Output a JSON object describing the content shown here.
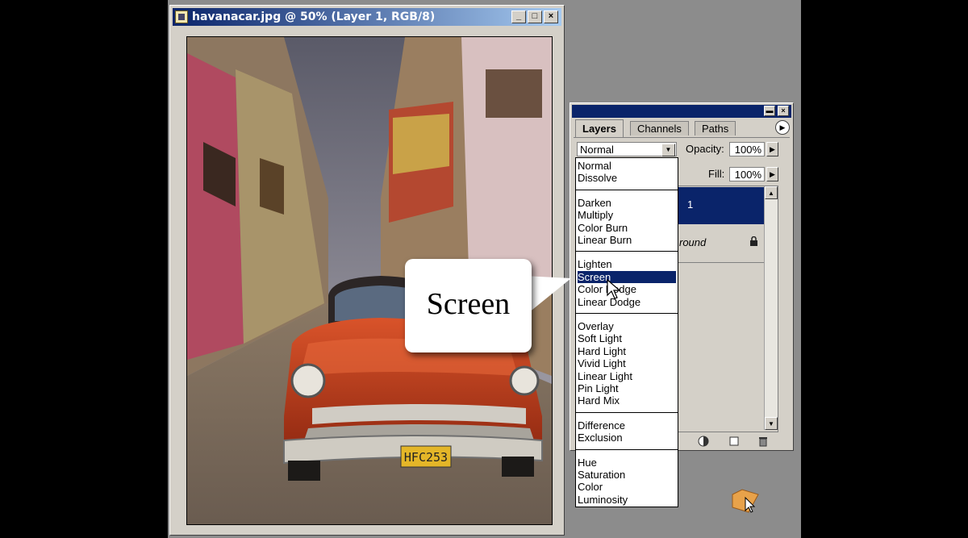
{
  "document": {
    "title": "havanacar.jpg @ 50% (Layer 1, RGB/8)",
    "buttons": {
      "minimize": "_",
      "maximize": "□",
      "close": "×"
    },
    "plate_text": "HFC253"
  },
  "layers_palette": {
    "tabs": [
      "Layers",
      "Channels",
      "Paths"
    ],
    "blend_mode": "Normal",
    "opacity_label": "Opacity:",
    "opacity_value": "100%",
    "fill_label": "Fill:",
    "fill_value": "100%",
    "layers": [
      {
        "name": "Layer 1",
        "visible_text": "1",
        "selected": true
      },
      {
        "name": "Background",
        "visible_text": "round",
        "locked": true
      }
    ]
  },
  "blend_menu": {
    "groups": [
      [
        "Normal",
        "Dissolve"
      ],
      [
        "Darken",
        "Multiply",
        "Color Burn",
        "Linear Burn"
      ],
      [
        "Lighten",
        "Screen",
        "Color Dodge",
        "Linear Dodge"
      ],
      [
        "Overlay",
        "Soft Light",
        "Hard Light",
        "Vivid Light",
        "Linear Light",
        "Pin Light",
        "Hard Mix"
      ],
      [
        "Difference",
        "Exclusion"
      ],
      [
        "Hue",
        "Saturation",
        "Color",
        "Luminosity"
      ]
    ],
    "selected": "Screen"
  },
  "callout": {
    "text": "Screen"
  },
  "colors": {
    "titlebar": "#0a246a",
    "selection": "#0a246a",
    "chrome": "#d4d0c8",
    "car_red": "#c43a17"
  }
}
